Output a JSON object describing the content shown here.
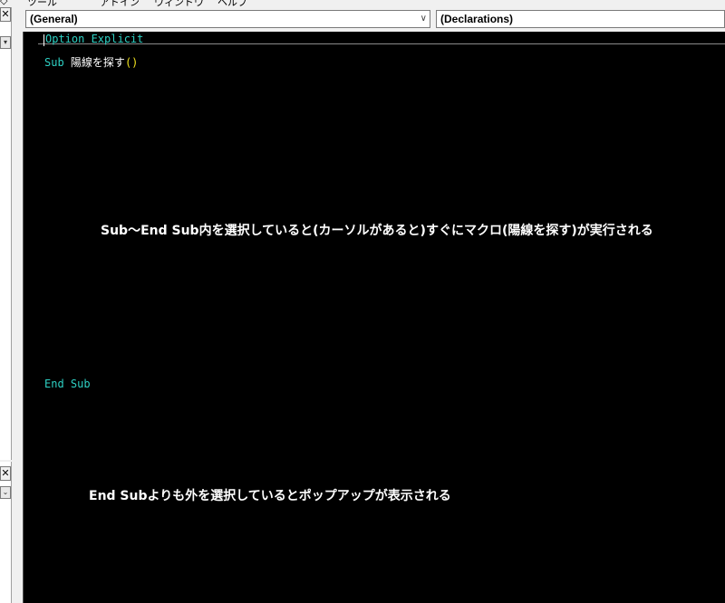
{
  "menu": {
    "items": [
      "◇",
      "ツール",
      "アドイン",
      "ウィンドウ",
      "ヘルプ"
    ]
  },
  "combos": {
    "object": "(General)",
    "procedure": "(Declarations)"
  },
  "code": {
    "line1": "Option Explicit",
    "sub_keyword": "Sub",
    "sub_name": "陽線を探す",
    "parens": "()",
    "end_sub": "End Sub"
  },
  "notes": {
    "inside": "Sub～End  Sub内を選択していると(カーソルがあると)すぐにマクロ(陽線を探す)が実行される",
    "outside": "End  Subよりも外を選択しているとポップアップが表示される"
  },
  "colors": {
    "keyword": "#2ed1c4",
    "paren": "#f2e31e",
    "editor_bg": "#000000"
  }
}
